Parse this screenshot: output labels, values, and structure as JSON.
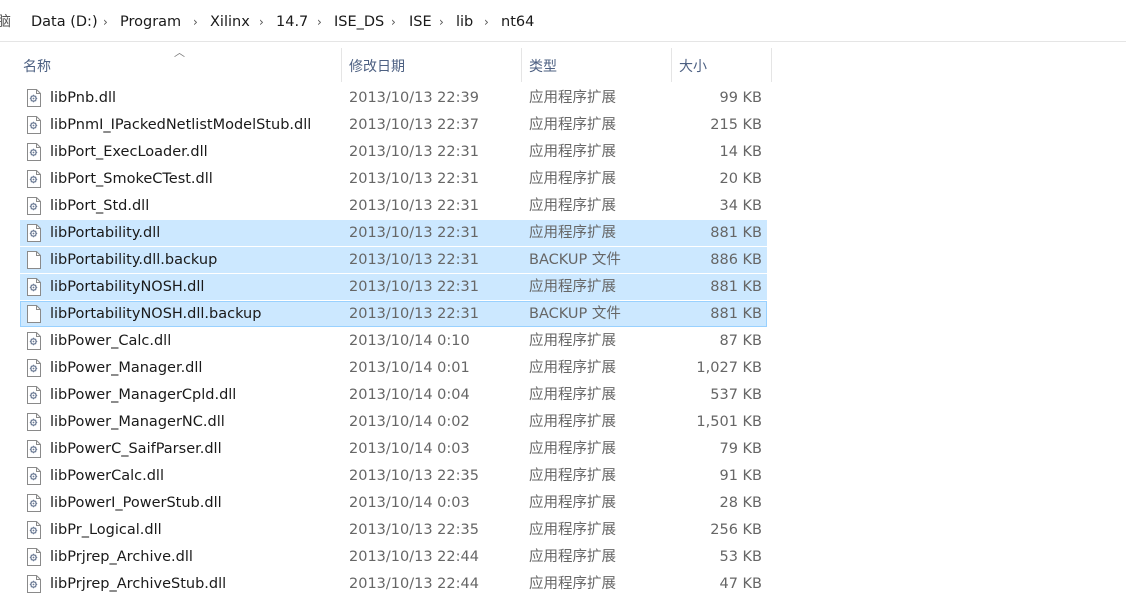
{
  "address": {
    "crumbs": [
      "Data (D:)",
      "Program",
      "Xilinx",
      "14.7",
      "ISE_DS",
      "ISE",
      "lib",
      "nt64"
    ],
    "separator": "›"
  },
  "columns": {
    "name": "名称",
    "date": "修改日期",
    "type": "类型",
    "size": "大小"
  },
  "files": [
    {
      "name": "libPnb.dll",
      "date": "2013/10/13 22:39",
      "type": "应用程序扩展",
      "size": "99 KB",
      "icon": "dll-icon",
      "selected": false
    },
    {
      "name": "libPnmI_IPackedNetlistModelStub.dll",
      "date": "2013/10/13 22:37",
      "type": "应用程序扩展",
      "size": "215 KB",
      "icon": "dll-icon",
      "selected": false
    },
    {
      "name": "libPort_ExecLoader.dll",
      "date": "2013/10/13 22:31",
      "type": "应用程序扩展",
      "size": "14 KB",
      "icon": "dll-icon",
      "selected": false
    },
    {
      "name": "libPort_SmokeCTest.dll",
      "date": "2013/10/13 22:31",
      "type": "应用程序扩展",
      "size": "20 KB",
      "icon": "dll-icon",
      "selected": false
    },
    {
      "name": "libPort_Std.dll",
      "date": "2013/10/13 22:31",
      "type": "应用程序扩展",
      "size": "34 KB",
      "icon": "dll-icon",
      "selected": false
    },
    {
      "name": "libPortability.dll",
      "date": "2013/10/13 22:31",
      "type": "应用程序扩展",
      "size": "881 KB",
      "icon": "dll-icon",
      "selected": true
    },
    {
      "name": "libPortability.dll.backup",
      "date": "2013/10/13 22:31",
      "type": "BACKUP 文件",
      "size": "886 KB",
      "icon": "file-icon",
      "selected": true
    },
    {
      "name": "libPortabilityNOSH.dll",
      "date": "2013/10/13 22:31",
      "type": "应用程序扩展",
      "size": "881 KB",
      "icon": "dll-icon",
      "selected": true
    },
    {
      "name": "libPortabilityNOSH.dll.backup",
      "date": "2013/10/13 22:31",
      "type": "BACKUP 文件",
      "size": "881 KB",
      "icon": "file-icon",
      "selected": true,
      "focused": true
    },
    {
      "name": "libPower_Calc.dll",
      "date": "2013/10/14 0:10",
      "type": "应用程序扩展",
      "size": "87 KB",
      "icon": "dll-icon",
      "selected": false
    },
    {
      "name": "libPower_Manager.dll",
      "date": "2013/10/14 0:01",
      "type": "应用程序扩展",
      "size": "1,027 KB",
      "icon": "dll-icon",
      "selected": false
    },
    {
      "name": "libPower_ManagerCpld.dll",
      "date": "2013/10/14 0:04",
      "type": "应用程序扩展",
      "size": "537 KB",
      "icon": "dll-icon",
      "selected": false
    },
    {
      "name": "libPower_ManagerNC.dll",
      "date": "2013/10/14 0:02",
      "type": "应用程序扩展",
      "size": "1,501 KB",
      "icon": "dll-icon",
      "selected": false
    },
    {
      "name": "libPowerC_SaifParser.dll",
      "date": "2013/10/14 0:03",
      "type": "应用程序扩展",
      "size": "79 KB",
      "icon": "dll-icon",
      "selected": false
    },
    {
      "name": "libPowerCalc.dll",
      "date": "2013/10/13 22:35",
      "type": "应用程序扩展",
      "size": "91 KB",
      "icon": "dll-icon",
      "selected": false
    },
    {
      "name": "libPowerI_PowerStub.dll",
      "date": "2013/10/14 0:03",
      "type": "应用程序扩展",
      "size": "28 KB",
      "icon": "dll-icon",
      "selected": false
    },
    {
      "name": "libPr_Logical.dll",
      "date": "2013/10/13 22:35",
      "type": "应用程序扩展",
      "size": "256 KB",
      "icon": "dll-icon",
      "selected": false
    },
    {
      "name": "libPrjrep_Archive.dll",
      "date": "2013/10/13 22:44",
      "type": "应用程序扩展",
      "size": "53 KB",
      "icon": "dll-icon",
      "selected": false
    },
    {
      "name": "libPrjrep_ArchiveStub.dll",
      "date": "2013/10/13 22:44",
      "type": "应用程序扩展",
      "size": "47 KB",
      "icon": "dll-icon",
      "selected": false
    }
  ]
}
